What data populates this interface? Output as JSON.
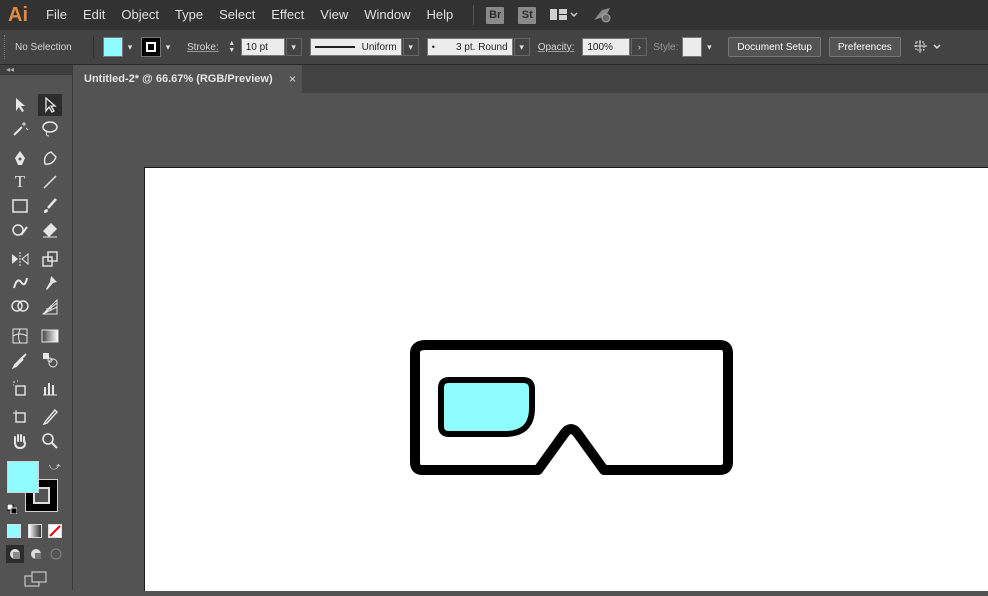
{
  "app": {
    "logo_text": "Ai",
    "accent": "#e08a4a"
  },
  "menu": [
    "File",
    "Edit",
    "Object",
    "Type",
    "Select",
    "Effect",
    "View",
    "Window",
    "Help"
  ],
  "app_buttons": {
    "bridge": "Br",
    "stock": "St"
  },
  "control": {
    "selection_status": "No Selection",
    "fill_color": "#8ffcff",
    "stroke_label": "Stroke:",
    "stroke_weight": "10 pt",
    "profile": "Uniform",
    "brush": "3 pt. Round",
    "opacity_label": "Opacity:",
    "opacity_value": "100%",
    "style_label": "Style:",
    "document_setup": "Document Setup",
    "preferences": "Preferences"
  },
  "document_tab": {
    "title": "Untitled-2* @ 66.67% (RGB/Preview)",
    "close": "×"
  },
  "colors": {
    "fill": "#8ffcff",
    "stroke": "#000000",
    "artboard": "#ffffff",
    "ui_bg": "#535353"
  }
}
